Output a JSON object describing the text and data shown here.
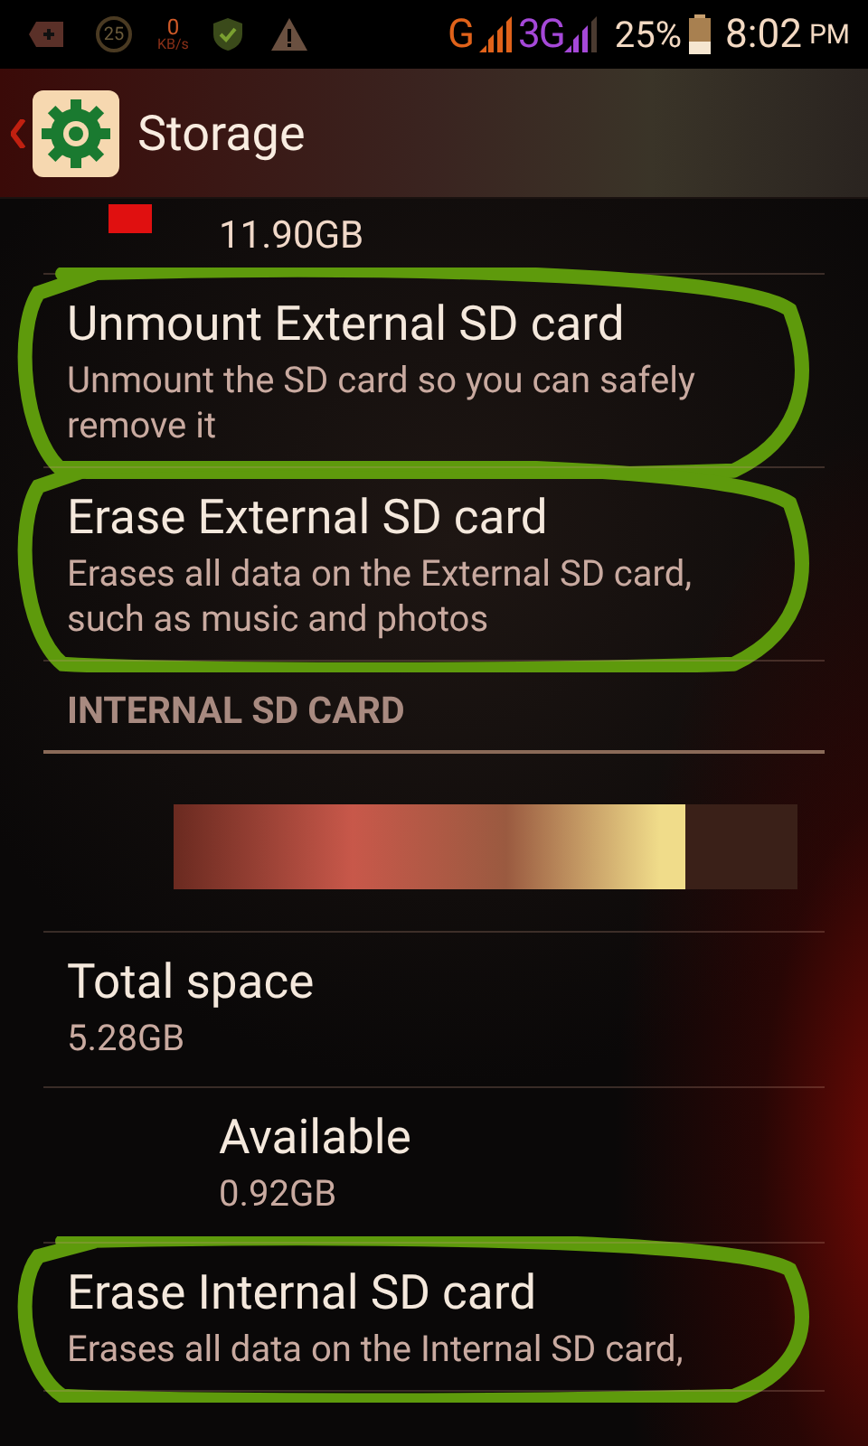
{
  "status_bar": {
    "notification_count": "25",
    "speed_value": "0",
    "speed_unit": "KB/s",
    "network_1": "G",
    "network_2": "3G",
    "battery": "25%",
    "time": "8:02",
    "ampm": "PM"
  },
  "action_bar": {
    "title": "Storage"
  },
  "items": [
    {
      "kind": "legend",
      "color": "#e01010",
      "value": "11.90GB"
    },
    {
      "kind": "pref",
      "title": "Unmount External SD card",
      "summary": "Unmount the SD card so you can safely remove it",
      "circled": true
    },
    {
      "kind": "pref",
      "title": "Erase External SD card",
      "summary": "Erases all data on the External SD card, such as music and photos",
      "circled": true
    },
    {
      "kind": "category",
      "title": "INTERNAL SD CARD"
    },
    {
      "kind": "bar",
      "level": 0.82
    },
    {
      "kind": "pref",
      "title": "Total space",
      "summary": "5.28GB",
      "circled": false
    },
    {
      "kind": "sub",
      "title": "Available",
      "summary": "0.92GB",
      "circled": false
    },
    {
      "kind": "pref",
      "title": "Erase Internal SD card",
      "summary": "Erases all data on the Internal SD card,",
      "circled": true
    }
  ]
}
